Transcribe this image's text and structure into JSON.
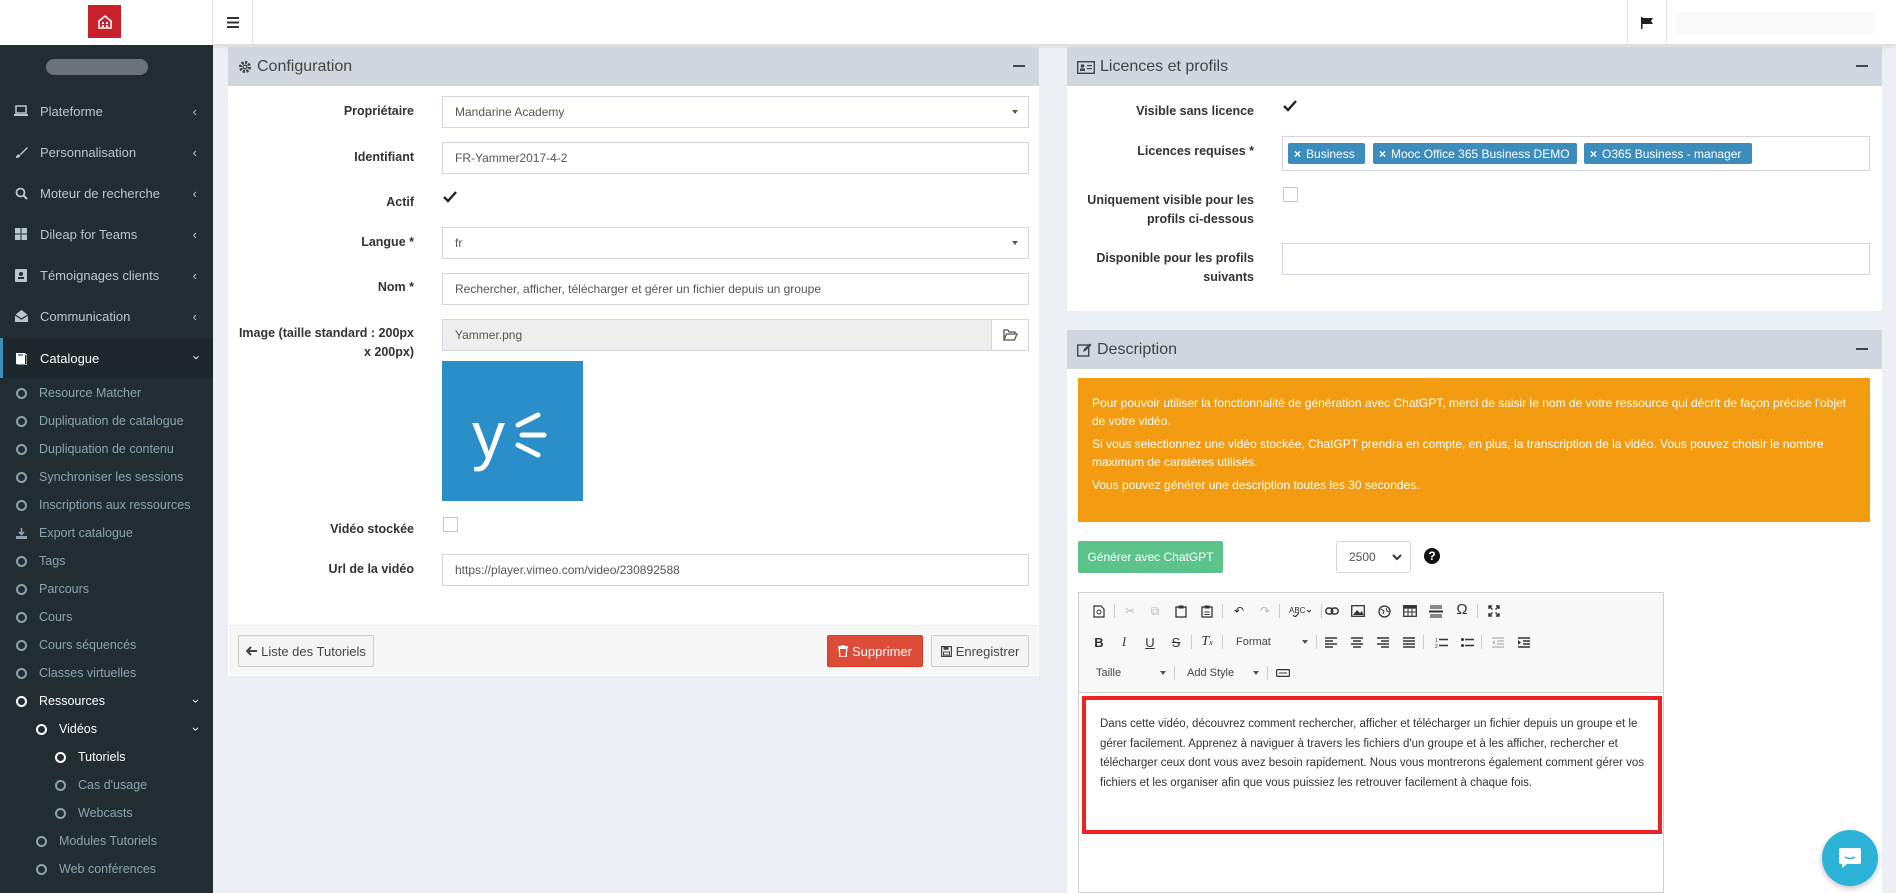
{
  "sidebar": {
    "items": [
      {
        "label": "Plateforme",
        "icon": "laptop-icon"
      },
      {
        "label": "Personnalisation",
        "icon": "brush-icon"
      },
      {
        "label": "Moteur de recherche",
        "icon": "search-icon"
      },
      {
        "label": "Dileap for Teams",
        "icon": "windows-icon"
      },
      {
        "label": "Témoignages clients",
        "icon": "id-card-icon"
      },
      {
        "label": "Communication",
        "icon": "envelope-open-icon"
      },
      {
        "label": "Catalogue",
        "icon": "book-icon"
      }
    ],
    "catalogue_sub": [
      "Resource Matcher",
      "Dupliquation de catalogue",
      "Dupliquation de contenu",
      "Synchroniser les sessions",
      "Inscriptions aux ressources",
      "Export catalogue",
      "Tags",
      "Parcours",
      "Cours",
      "Cours séquencés",
      "Classes virtuelles",
      "Ressources"
    ],
    "ressources_sub": [
      "Vidéos"
    ],
    "videos_sub": [
      "Tutoriels",
      "Cas d'usage",
      "Webcasts"
    ],
    "after": [
      "Modules Tutoriels",
      "Web conférences"
    ]
  },
  "config": {
    "title": "Configuration",
    "owner_label": "Propriétaire",
    "owner_value": "Mandarine Academy",
    "id_label": "Identifiant",
    "id_value": "FR-Yammer2017-4-2",
    "active_label": "Actif",
    "lang_label": "Langue *",
    "lang_value": "fr",
    "name_label": "Nom *",
    "name_value": "Rechercher, afficher, télécharger et gérer un fichier depuis un groupe",
    "image_label": "Image (taille standard : 200px x 200px)",
    "image_value": "Yammer.png",
    "stored_label": "Vidéo stockée",
    "url_label": "Url de la vidéo",
    "url_value": "https://player.vimeo.com/video/230892588",
    "back_button": "Liste des Tutoriels",
    "delete_button": "Supprimer",
    "save_button": "Enregistrer"
  },
  "licences": {
    "title": "Licences et profils",
    "visible_label": "Visible sans licence",
    "required_label": "Licences requises *",
    "tags": [
      "Business",
      "Mooc Office 365 Business DEMO",
      "O365 Business - manager"
    ],
    "only_visible_label": "Uniquement visible pour les profils ci-dessous",
    "available_label": "Disponible pour les profils suivants"
  },
  "description": {
    "title": "Description",
    "alert_p1": "Pour pouvoir utiliser la fonctionnalité de génération avec ChatGPT, merci de saisir le nom de votre ressource qui décrit de façon précise l'objet de votre vidéo.",
    "alert_p2": "Si vous selectionnez une vidéo stockée, ChatGPT prendra en compte, en plus, la transcription de la vidéo. Vous pouvez choisir le nombre maximum de caratères utilisés.",
    "alert_p3": "Vous pouvez générer une description toutes les 30 secondes.",
    "generate_button": "Générer avec ChatGPT",
    "max_chars": "2500",
    "format_label": "Format",
    "size_label": "Taille",
    "style_label": "Add Style",
    "body_text": "Dans cette vidéo, découvrez comment rechercher, afficher et télécharger un fichier depuis un groupe et le gérer facilement. Apprenez à naviguer à travers les fichiers d'un groupe et à les afficher, rechercher et télécharger ceux dont vous avez besoin rapidement. Nous vous montrerons également comment gérer vos fichiers et les organiser afin que vous puissiez les retrouver facilement à chaque fois."
  },
  "colors": {
    "sidebar_bg": "#222d32",
    "brand_red": "#c9202b",
    "alert_orange": "#f39c12",
    "tag_blue": "#3c8dbc",
    "generate_green": "#5cc48a",
    "delete_red": "#dd4b39",
    "highlight_red": "#ee2222",
    "yammer_blue": "#2a8fc8"
  }
}
